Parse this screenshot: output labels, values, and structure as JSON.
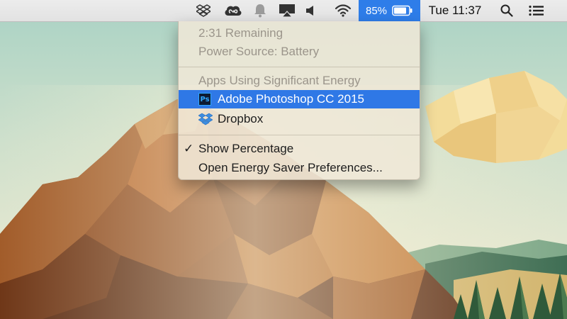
{
  "menubar": {
    "icons": [
      "dropbox-icon",
      "creative-cloud-icon",
      "notification-bell-icon",
      "airplay-icon",
      "volume-icon",
      "wifi-icon"
    ],
    "battery": {
      "percent_text": "85%",
      "level": 0.85
    },
    "clock": "Tue 11:37",
    "right_icons": [
      "spotlight-search-icon",
      "notification-center-icon"
    ],
    "accent": "#2e7de9"
  },
  "battery_menu": {
    "time_remaining": "2:31 Remaining",
    "power_source": "Power Source: Battery",
    "apps_header": "Apps Using Significant Energy",
    "apps": [
      {
        "name": "Adobe Photoshop CC 2015",
        "icon": "photoshop-icon",
        "icon_text": "Ps",
        "highlighted": true
      },
      {
        "name": "Dropbox",
        "icon": "dropbox-icon",
        "highlighted": false
      }
    ],
    "show_percentage": {
      "label": "Show Percentage",
      "checked": true,
      "check_glyph": "✓"
    },
    "energy_saver": "Open Energy Saver Preferences...",
    "highlight_color": "#2f78e6"
  }
}
